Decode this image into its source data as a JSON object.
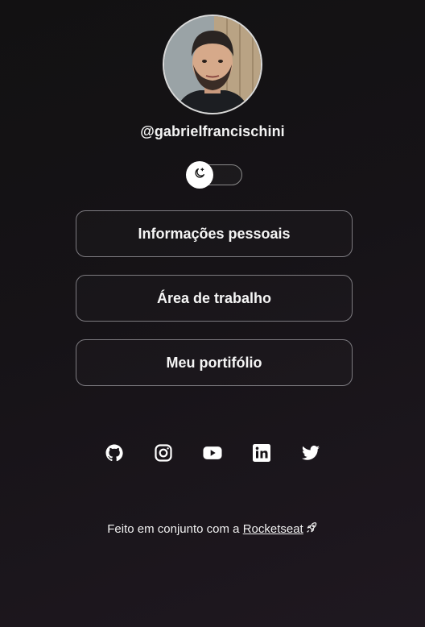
{
  "profile": {
    "username": "@gabrielfrancischini"
  },
  "theme_toggle": {
    "icon": "moon-stars-icon",
    "state": "dark"
  },
  "links": [
    {
      "label": "Informações pessoais"
    },
    {
      "label": "Área de trabalho"
    },
    {
      "label": "Meu portifólio"
    }
  ],
  "social": [
    "github-icon",
    "instagram-icon",
    "youtube-icon",
    "linkedin-icon",
    "twitter-icon"
  ],
  "footer": {
    "text": "Feito em conjunto com a ",
    "link_label": "Rocketseat",
    "icon": "rocket-icon"
  }
}
